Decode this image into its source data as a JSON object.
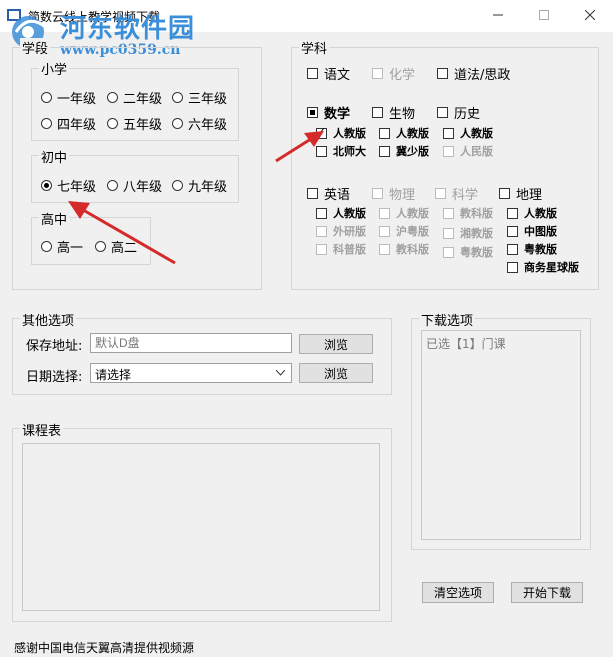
{
  "window": {
    "title": "简数云线上教学视频下载"
  },
  "watermark": {
    "name": "河东软件园",
    "url": "www.pc0359.cn"
  },
  "stage": {
    "legend": "学段",
    "primary": {
      "legend": "小学",
      "options": [
        "一年级",
        "二年级",
        "三年级",
        "四年级",
        "五年级",
        "六年级"
      ]
    },
    "junior": {
      "legend": "初中",
      "options": [
        "七年级",
        "八年级",
        "九年级"
      ],
      "selected": "七年级"
    },
    "senior": {
      "legend": "高中",
      "options": [
        "高一",
        "高二"
      ]
    }
  },
  "subjects": {
    "legend": "学科",
    "chinese": "语文",
    "chemistry": "化学",
    "politics": "道法/思政",
    "math": "数学",
    "biology": "生物",
    "history": "历史",
    "math_editions": [
      "人教版",
      "北师大"
    ],
    "bio_editions": [
      "人教版",
      "冀少版"
    ],
    "hist_editions": [
      "人教版",
      "人民版"
    ],
    "english": "英语",
    "physics": "物理",
    "science": "科学",
    "geography": "地理",
    "eng_editions": [
      "人教版",
      "外研版",
      "科普版"
    ],
    "phys_editions": [
      "人教版",
      "沪粤版",
      "教科版"
    ],
    "sci_editions": [
      "教科版",
      "湘教版",
      "粤教版"
    ],
    "geo_editions": [
      "人教版",
      "中图版",
      "粤教版",
      "商务星球版"
    ]
  },
  "other": {
    "legend": "其他选项",
    "save_label": "保存地址:",
    "save_placeholder": "默认D盘",
    "browse": "浏览",
    "date_label": "日期选择:",
    "date_value": "请选择"
  },
  "schedule": {
    "legend": "课程表"
  },
  "download": {
    "legend": "下载选项",
    "summary": "已选【1】门课"
  },
  "actions": {
    "clear": "清空选项",
    "start": "开始下载"
  },
  "footer": {
    "thanks": "感谢中国电信天翼高清提供视频源"
  },
  "colors": {
    "watermark": "#3b8ed8",
    "arrow": "#d42a2a"
  }
}
